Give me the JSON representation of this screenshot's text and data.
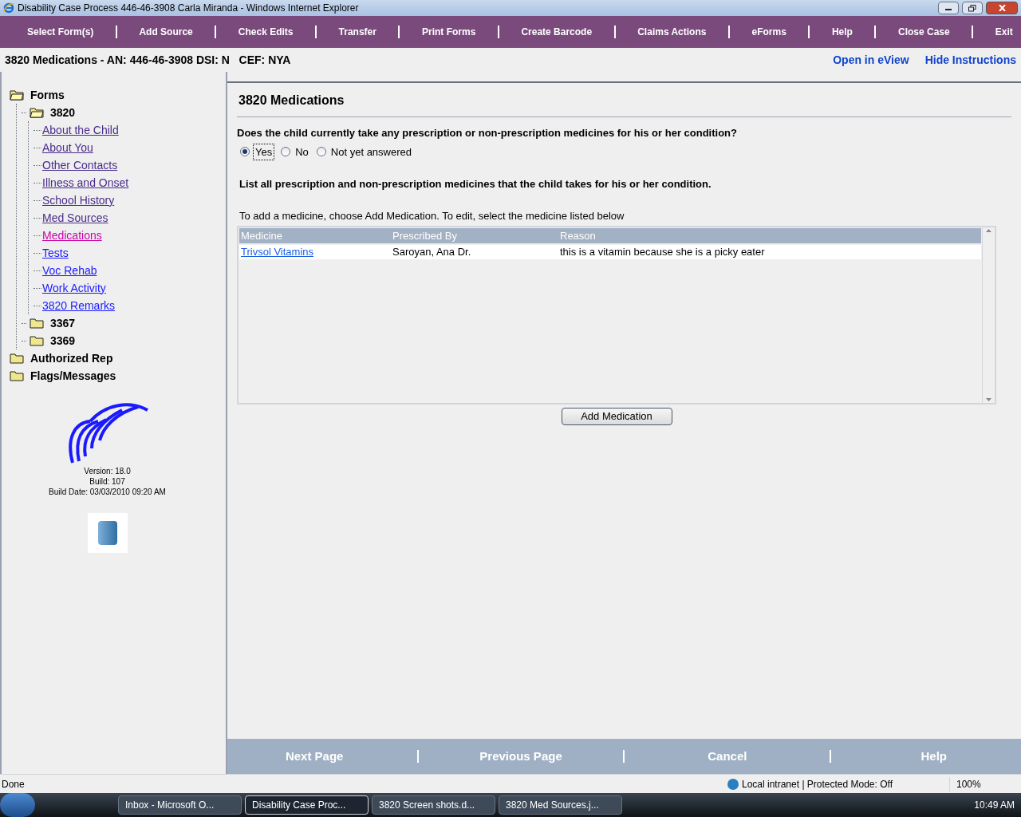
{
  "window": {
    "title": "Disability Case Process 446-46-3908 Carla Miranda - Windows Internet Explorer"
  },
  "menu": [
    "Select Form(s)",
    "Add Source",
    "Check Edits",
    "Transfer",
    "Print Forms",
    "Create Barcode",
    "Claims Actions",
    "eForms",
    "Help",
    "Close Case",
    "Exit"
  ],
  "header": {
    "case_info": "3820 Medications - AN: 446-46-3908 DSI: N   CEF: NYA",
    "links": [
      "Open in eView",
      "Hide Instructions"
    ]
  },
  "tree": [
    {
      "label": "Forms",
      "kind": "folder",
      "expanded": true,
      "children": [
        {
          "label": "3820",
          "kind": "folder",
          "expanded": true,
          "children": [
            {
              "label": "About the Child",
              "kind": "link",
              "visited": true,
              "selected": false
            },
            {
              "label": "About You",
              "kind": "link",
              "visited": true,
              "selected": false
            },
            {
              "label": "Other Contacts",
              "kind": "link",
              "visited": true,
              "selected": false
            },
            {
              "label": "Illness and Onset",
              "kind": "link",
              "visited": true,
              "selected": false
            },
            {
              "label": "School History",
              "kind": "link",
              "visited": true,
              "selected": false
            },
            {
              "label": "Med Sources",
              "kind": "link",
              "visited": true,
              "selected": false
            },
            {
              "label": "Medications",
              "kind": "link",
              "selected": true
            },
            {
              "label": "Tests",
              "kind": "link",
              "visited": false,
              "selected": false
            },
            {
              "label": "Voc Rehab",
              "kind": "link",
              "visited": false,
              "selected": false
            },
            {
              "label": "Work Activity",
              "kind": "link",
              "visited": false,
              "selected": false
            },
            {
              "label": "3820 Remarks",
              "kind": "link",
              "visited": false,
              "selected": false
            }
          ]
        },
        {
          "label": "3367",
          "kind": "folder",
          "expanded": false
        },
        {
          "label": "3369",
          "kind": "folder",
          "expanded": false
        }
      ]
    },
    {
      "label": "Authorized Rep",
      "kind": "folder",
      "expanded": false
    },
    {
      "label": "Flags/Messages",
      "kind": "folder",
      "expanded": false
    }
  ],
  "version_info": [
    "Version: 18.0",
    "Build: 107",
    "Build Date: 03/03/2010 09:20 AM"
  ],
  "form": {
    "title": "3820 Medications",
    "question": "Does the child currently take any prescription or non-prescription medicines for his or her condition?",
    "options": [
      {
        "label": "Yes",
        "selected": true
      },
      {
        "label": "No",
        "selected": false
      },
      {
        "label": "Not yet answered",
        "selected": false
      }
    ],
    "instruction": "List all prescription and non-prescription medicines that the child takes for his or her condition.",
    "hint": "To add a medicine, choose Add Medication. To edit, select the medicine listed below",
    "table": {
      "columns": [
        "Medicine",
        "Prescribed By",
        "Reason"
      ],
      "rows": [
        [
          "Trivsol Vitamins",
          "Saroyan, Ana Dr.",
          "this is a vitamin because she is a picky eater"
        ]
      ]
    },
    "add_button": "Add Medication"
  },
  "footer_buttons": [
    "Next Page",
    "Previous Page",
    "Cancel",
    "Help"
  ],
  "status_bar": {
    "text": "Done",
    "zone": "Local intranet | Protected Mode: Off",
    "zoom": "100%"
  },
  "taskbar": {
    "items": [
      {
        "label": "Inbox - Microsoft O...",
        "selected": false
      },
      {
        "label": "Disability Case Proc...",
        "selected": true
      },
      {
        "label": "3820 Screen shots.d...",
        "selected": false
      },
      {
        "label": "3820 Med Sources.j...",
        "selected": false
      }
    ],
    "clock": "10:49 AM"
  }
}
